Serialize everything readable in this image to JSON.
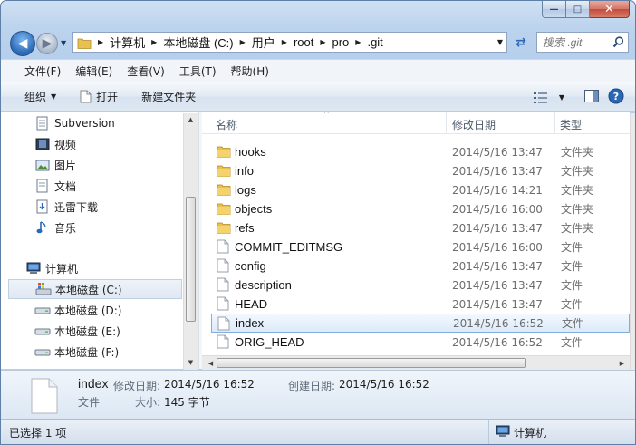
{
  "window": {
    "caption_min": "—",
    "caption_max": "□",
    "caption_close": "✕"
  },
  "address": {
    "crumbs": [
      "计算机",
      "本地磁盘 (C:)",
      "用户",
      "root",
      "pro",
      ".git"
    ],
    "search_placeholder": "搜索 .git"
  },
  "menu": [
    "文件(F)",
    "编辑(E)",
    "查看(V)",
    "工具(T)",
    "帮助(H)"
  ],
  "commands": {
    "organize": "组织",
    "open": "打开",
    "new_folder": "新建文件夹"
  },
  "nav": {
    "items": [
      {
        "label": "Subversion",
        "icon": "subversion-icon"
      },
      {
        "label": "视频",
        "icon": "video-icon"
      },
      {
        "label": "图片",
        "icon": "picture-icon"
      },
      {
        "label": "文档",
        "icon": "document-icon"
      },
      {
        "label": "迅雷下载",
        "icon": "download-icon"
      },
      {
        "label": "音乐",
        "icon": "music-icon"
      }
    ],
    "computer": "计算机",
    "drives": [
      {
        "label": "本地磁盘 (C:)",
        "selected": true
      },
      {
        "label": "本地磁盘 (D:)",
        "selected": false
      },
      {
        "label": "本地磁盘 (E:)",
        "selected": false
      },
      {
        "label": "本地磁盘 (F:)",
        "selected": false
      }
    ]
  },
  "columns": {
    "name": "名称",
    "date": "修改日期",
    "type": "类型"
  },
  "files": [
    {
      "name": "hooks",
      "date": "2014/5/16 13:47",
      "type": "文件夹",
      "kind": "folder"
    },
    {
      "name": "info",
      "date": "2014/5/16 13:47",
      "type": "文件夹",
      "kind": "folder"
    },
    {
      "name": "logs",
      "date": "2014/5/16 14:21",
      "type": "文件夹",
      "kind": "folder"
    },
    {
      "name": "objects",
      "date": "2014/5/16 16:00",
      "type": "文件夹",
      "kind": "folder"
    },
    {
      "name": "refs",
      "date": "2014/5/16 13:47",
      "type": "文件夹",
      "kind": "folder"
    },
    {
      "name": "COMMIT_EDITMSG",
      "date": "2014/5/16 16:00",
      "type": "文件",
      "kind": "file"
    },
    {
      "name": "config",
      "date": "2014/5/16 13:47",
      "type": "文件",
      "kind": "file"
    },
    {
      "name": "description",
      "date": "2014/5/16 13:47",
      "type": "文件",
      "kind": "file"
    },
    {
      "name": "HEAD",
      "date": "2014/5/16 13:47",
      "type": "文件",
      "kind": "file"
    },
    {
      "name": "index",
      "date": "2014/5/16 16:52",
      "type": "文件",
      "kind": "file",
      "selected": true
    },
    {
      "name": "ORIG_HEAD",
      "date": "2014/5/16 16:52",
      "type": "文件",
      "kind": "file"
    }
  ],
  "details": {
    "name": "index",
    "kind": "文件",
    "modified_label": "修改日期:",
    "modified": "2014/5/16 16:52",
    "created_label": "创建日期:",
    "created": "2014/5/16 16:52",
    "size_label": "大小:",
    "size": "145 字节"
  },
  "status": {
    "selection": "已选择 1 项",
    "location": "计算机"
  },
  "colors": {
    "accent": "#2a67b4",
    "folder": "#e8c14f",
    "selection": "#dbeaf9"
  }
}
